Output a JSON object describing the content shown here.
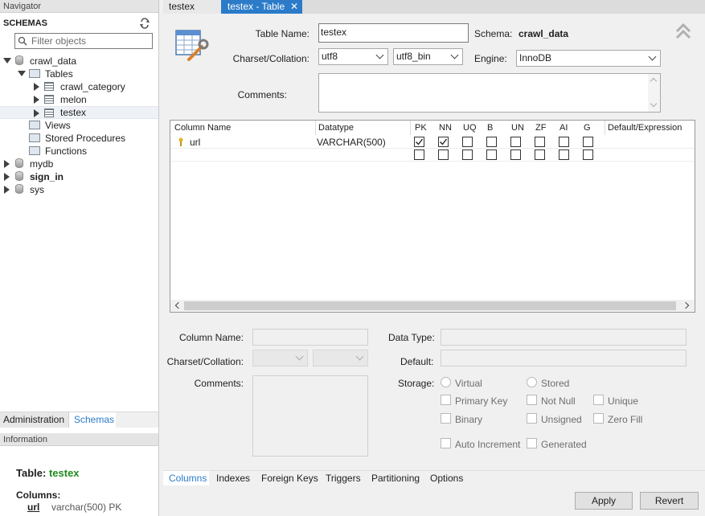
{
  "navigator": {
    "header": "Navigator",
    "schemas_title": "SCHEMAS",
    "filter_placeholder": "Filter objects",
    "tree": {
      "crawl_data": "crawl_data",
      "tables": "Tables",
      "table_items": [
        "crawl_category",
        "melon",
        "testex"
      ],
      "views": "Views",
      "stored_procedures": "Stored Procedures",
      "functions": "Functions",
      "mydb": "mydb",
      "sign_in": "sign_in",
      "sys": "sys"
    },
    "bottom_tabs": [
      "Administration",
      "Schemas"
    ],
    "information_header": "Information",
    "info": {
      "table_label": "Table:",
      "table_name": "testex",
      "columns_label": "Columns:",
      "column_name": "url",
      "column_type": "varchar(500) PK"
    }
  },
  "tabs": [
    "testex",
    "testex - Table"
  ],
  "form": {
    "table_name_label": "Table Name:",
    "table_name_value": "testex",
    "schema_label": "Schema:",
    "schema_value": "crawl_data",
    "charset_label": "Charset/Collation:",
    "charset_value": "utf8",
    "collation_value": "utf8_bin",
    "engine_label": "Engine:",
    "engine_value": "InnoDB",
    "comments_label": "Comments:"
  },
  "grid": {
    "headers": [
      "Column Name",
      "Datatype",
      "PK",
      "NN",
      "UQ",
      "B",
      "UN",
      "ZF",
      "AI",
      "G",
      "Default/Expression"
    ],
    "rows": [
      {
        "name": "url",
        "type": "VARCHAR(500)",
        "flags": [
          true,
          true,
          false,
          false,
          false,
          false,
          false,
          false
        ]
      },
      {
        "name": "",
        "type": "",
        "flags": [
          false,
          false,
          false,
          false,
          false,
          false,
          false,
          false
        ]
      }
    ]
  },
  "details": {
    "column_name_label": "Column Name:",
    "data_type_label": "Data Type:",
    "charset_label": "Charset/Collation:",
    "default_label": "Default:",
    "comments_label": "Comments:",
    "storage_label": "Storage:",
    "virtual": "Virtual",
    "stored": "Stored",
    "primary_key": "Primary Key",
    "not_null": "Not Null",
    "unique": "Unique",
    "binary": "Binary",
    "unsigned": "Unsigned",
    "zero_fill": "Zero Fill",
    "auto_increment": "Auto Increment",
    "generated": "Generated"
  },
  "bottom_tabs": [
    "Columns",
    "Indexes",
    "Foreign Keys",
    "Triggers",
    "Partitioning",
    "Options"
  ],
  "buttons": {
    "apply": "Apply",
    "revert": "Revert"
  },
  "colors": {
    "accent": "#2b7bc9",
    "green": "#1e8a1e"
  }
}
